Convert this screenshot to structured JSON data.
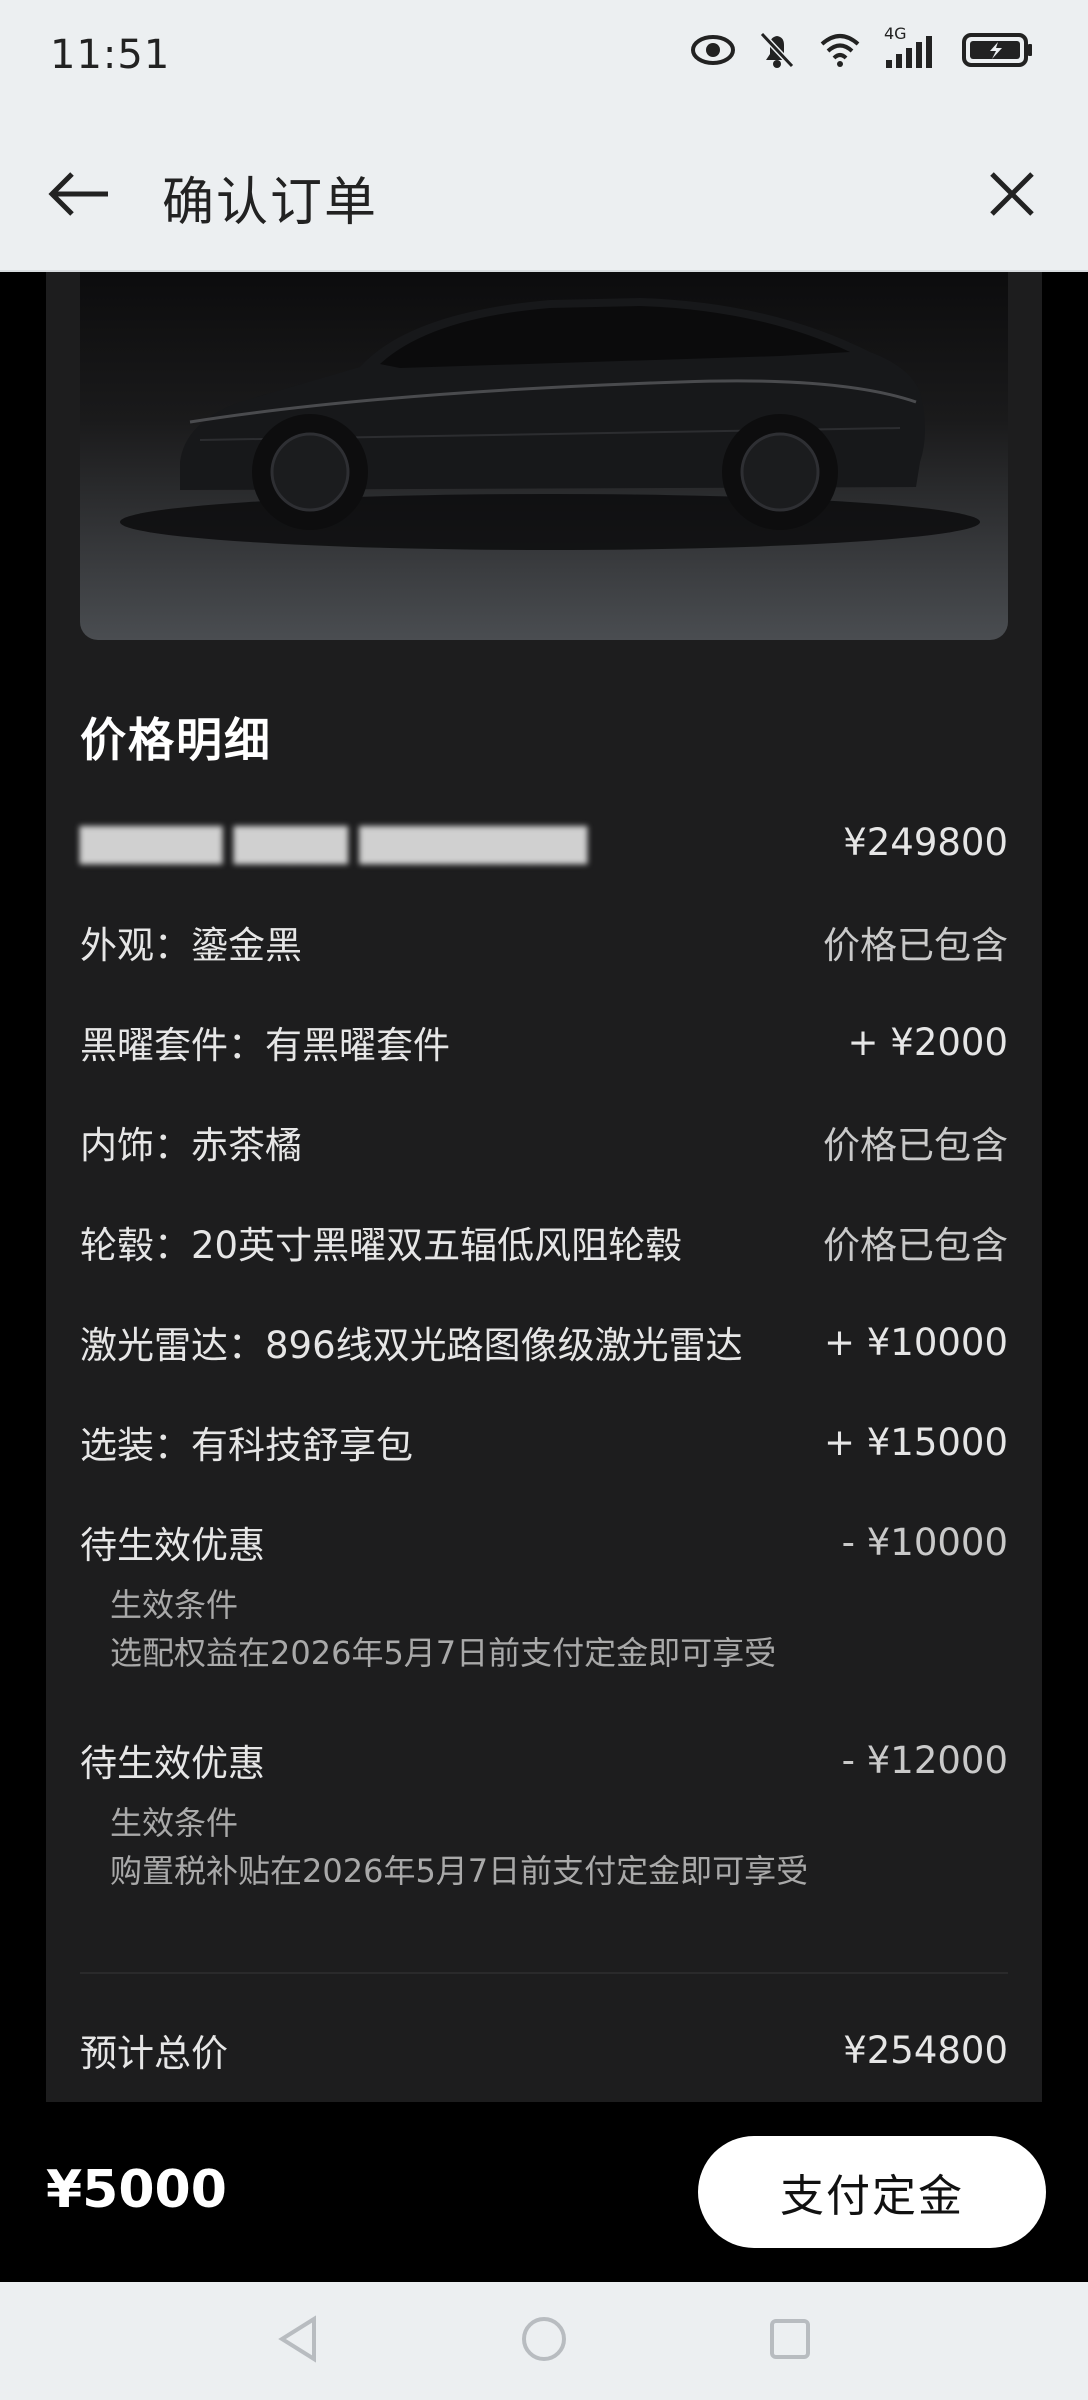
{
  "status_bar": {
    "time": "11:51",
    "network_label": "4G",
    "icons": [
      "eye-icon",
      "mute-icon",
      "wifi-icon",
      "signal-icon",
      "battery-icon"
    ]
  },
  "header": {
    "title": "确认订单",
    "back_icon": "arrow-left-icon",
    "close_icon": "close-icon"
  },
  "price_detail": {
    "title": "价格明细",
    "base": {
      "label": "▇▇▇▇▇ ▇▇▇▇ ▇▇▇▇▇▇▇▇",
      "value": "¥249800"
    },
    "items": [
      {
        "label": "外观：鎏金黑",
        "value": "价格已包含"
      },
      {
        "label": "黑曜套件：有黑曜套件",
        "value": "+ ¥2000"
      },
      {
        "label": "内饰：赤茶橘",
        "value": "价格已包含"
      },
      {
        "label": "轮毂：20英寸黑曜双五辐低风阻轮毂",
        "value": "价格已包含"
      },
      {
        "label": "激光雷达：896线双光路图像级激光雷达",
        "value": "+ ¥10000"
      },
      {
        "label": "选装：有科技舒享包",
        "value": "+ ¥15000"
      }
    ],
    "discounts": [
      {
        "label": "待生效优惠",
        "value": "- ¥10000",
        "cond_title": "生效条件",
        "cond_text": "选配权益在2026年5月7日前支付定金即可享受"
      },
      {
        "label": "待生效优惠",
        "value": "- ¥12000",
        "cond_title": "生效条件",
        "cond_text": "购置税补贴在2026年5月7日前支付定金即可享受"
      }
    ],
    "total": {
      "label": "预计总价",
      "value": "¥254800"
    }
  },
  "bottom_bar": {
    "deposit": "¥5000",
    "pay_label": "支付定金"
  },
  "colors": {
    "card_bg": "#1d1d1e",
    "page_bg": "#000000",
    "system_bar_bg": "#eceff1",
    "button_bg": "#ffffff"
  }
}
